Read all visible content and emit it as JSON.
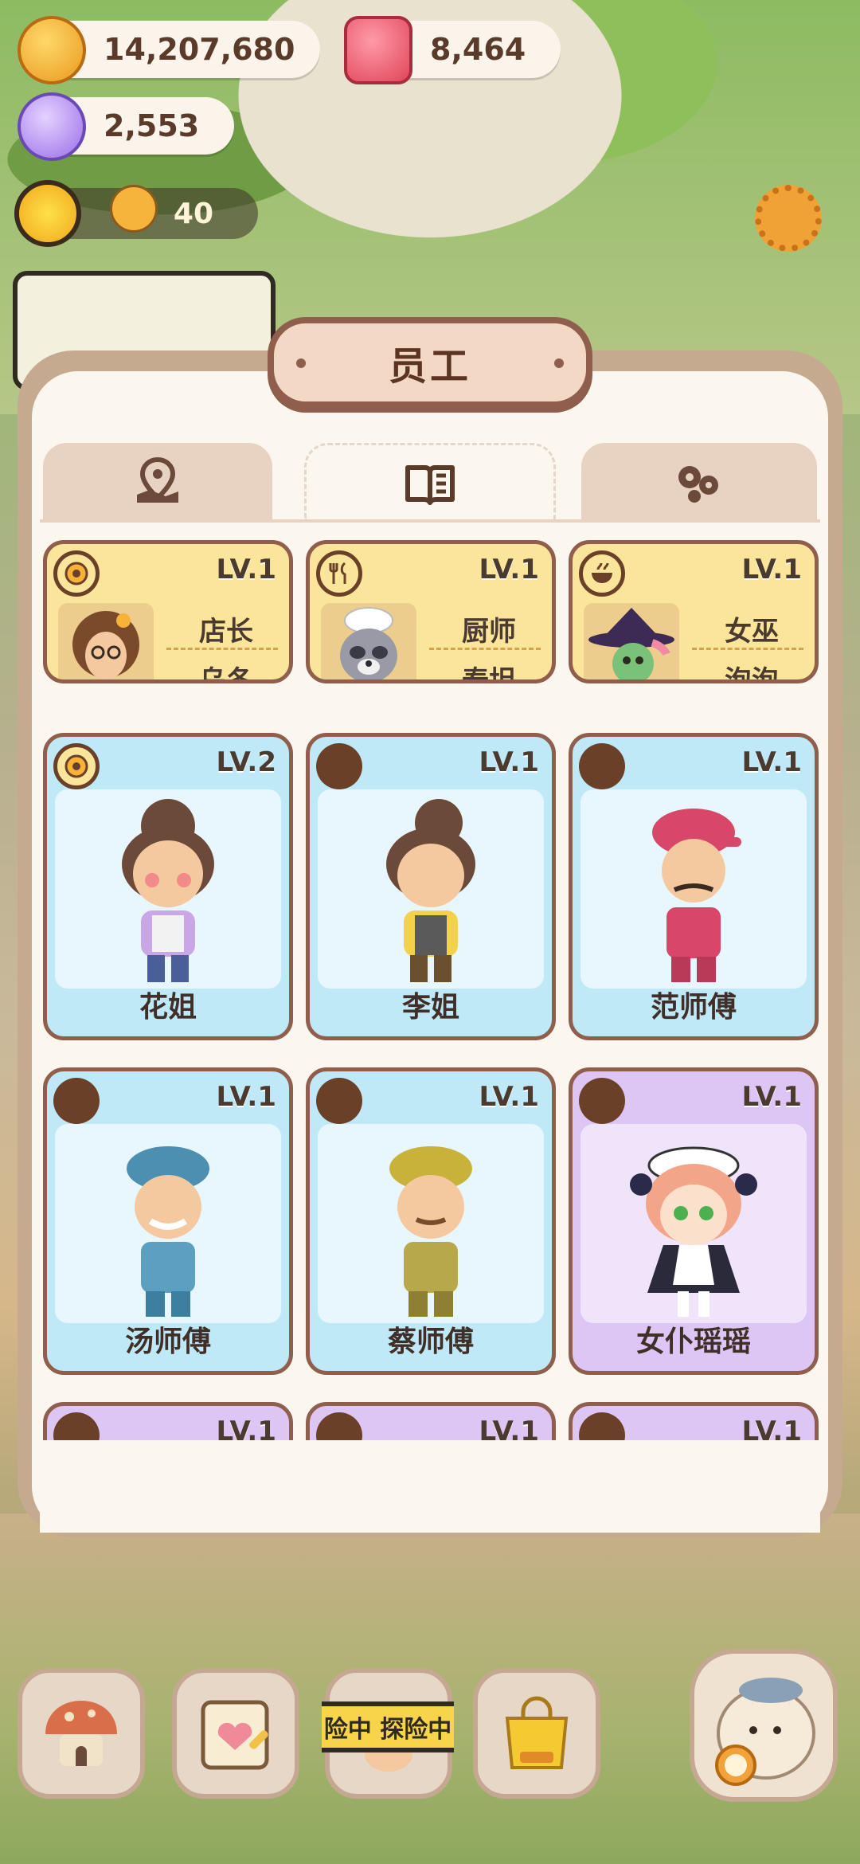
{
  "resources": {
    "coins": "14,207,680",
    "gems": "8,464",
    "crystals": "2,553",
    "level_count": "40"
  },
  "panel": {
    "title": "员工"
  },
  "tabs": [
    {
      "icon": "map-pin-icon",
      "active": false
    },
    {
      "icon": "book-icon",
      "active": true
    },
    {
      "icon": "bubbles-icon",
      "active": false
    }
  ],
  "staff_special": [
    {
      "level": "LV.1",
      "role": "店长",
      "name": "乌冬",
      "badge_icon": "flower-icon"
    },
    {
      "level": "LV.1",
      "role": "厨师",
      "name": "泰坦",
      "badge_icon": "fork-knife-icon"
    },
    {
      "level": "LV.1",
      "role": "女巫",
      "name": "泡泡",
      "badge_icon": "bowl-icon"
    }
  ],
  "staff": [
    {
      "level": "LV.2",
      "name": "花姐",
      "theme": "blue",
      "badge": "flower"
    },
    {
      "level": "LV.1",
      "name": "李姐",
      "theme": "blue",
      "badge": "empty"
    },
    {
      "level": "LV.1",
      "name": "范师傅",
      "theme": "blue",
      "badge": "empty"
    },
    {
      "level": "LV.1",
      "name": "汤师傅",
      "theme": "blue",
      "badge": "empty"
    },
    {
      "level": "LV.1",
      "name": "蔡师傅",
      "theme": "blue",
      "badge": "empty"
    },
    {
      "level": "LV.1",
      "name": "女仆瑶瑶",
      "theme": "purple",
      "badge": "empty"
    }
  ],
  "partial_row": [
    "LV.1",
    "LV.1",
    "LV.1"
  ],
  "bottom_bar": {
    "explore_label": "险中 探险中"
  },
  "colors": {
    "gold_card": "#fbe59a",
    "blue_card": "#bfe9f7",
    "purple_card": "#ddc6f4",
    "border_brown": "#8f5e4c"
  }
}
